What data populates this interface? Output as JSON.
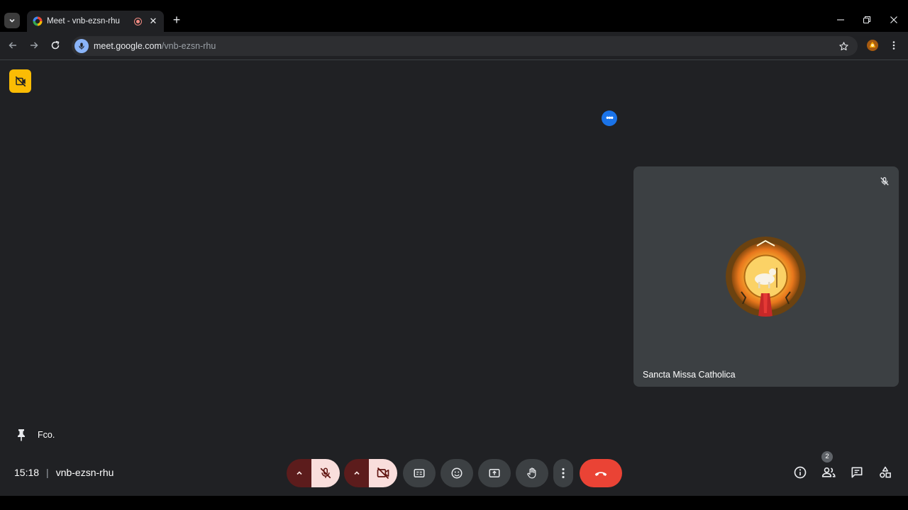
{
  "browser": {
    "tab_title": "Meet - vnb-ezsn-rhu",
    "url_host": "meet.google.com",
    "url_path": "/vnb-ezsn-rhu",
    "icons": [
      "tab-search-icon",
      "meet-favicon",
      "recording-icon",
      "close-tab-icon",
      "new-tab-icon",
      "minimize-icon",
      "restore-icon",
      "close-window-icon",
      "back-icon",
      "forward-icon",
      "reload-icon",
      "site-info-icon",
      "bookmark-star-icon",
      "extension-icon",
      "browser-menu-icon"
    ]
  },
  "meeting": {
    "time": "15:18",
    "code": "vnb-ezsn-rhu",
    "pinned_name": "Fco.",
    "participant_count": "2"
  },
  "tile": {
    "name": "Sancta Missa Catholica"
  },
  "controls": {
    "icons": [
      "mic-off-icon",
      "camera-off-icon",
      "captions-icon",
      "emoji-icon",
      "present-icon",
      "raise-hand-icon",
      "more-options-icon",
      "hang-up-icon"
    ],
    "right_icons": [
      "info-icon",
      "people-icon",
      "chat-icon",
      "activities-icon"
    ]
  },
  "colors": {
    "stage_bg": "#202124",
    "tile_bg": "#3c4043",
    "hangup": "#ea4335",
    "off_state": "#f9dedc",
    "warning": "#fbbc04",
    "accent": "#1a73e8"
  }
}
